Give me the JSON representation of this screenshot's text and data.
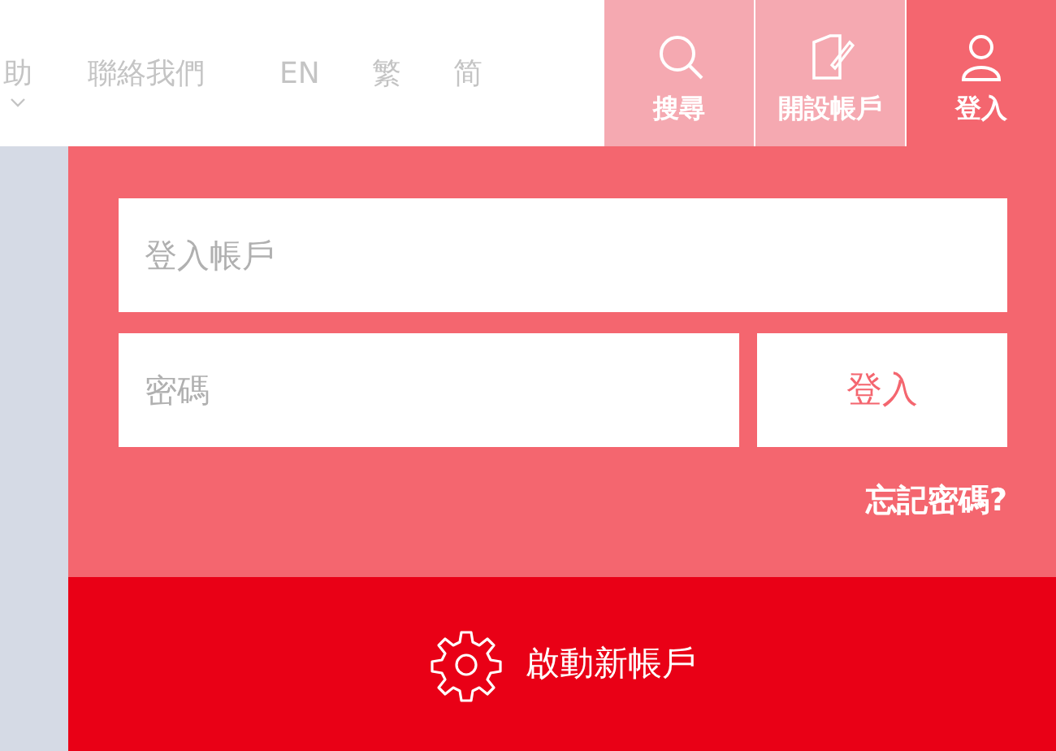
{
  "nav_links": [
    {
      "label": "助",
      "has_dropdown": true
    },
    {
      "label": "聯絡我們",
      "has_dropdown": false
    }
  ],
  "languages": [
    "EN",
    "繁",
    "简"
  ],
  "header_tiles": [
    {
      "kind": "search",
      "label": "搜尋",
      "selected": false
    },
    {
      "kind": "register",
      "label": "開設帳戶",
      "selected": false
    },
    {
      "kind": "user",
      "label": "登入",
      "selected": true
    }
  ],
  "login_form": {
    "account_placeholder": "登入帳戶",
    "password_placeholder": "密碼",
    "submit": "登入",
    "forgot_link": "忘記密碼?"
  },
  "activate_button": "啟動新帳戶"
}
